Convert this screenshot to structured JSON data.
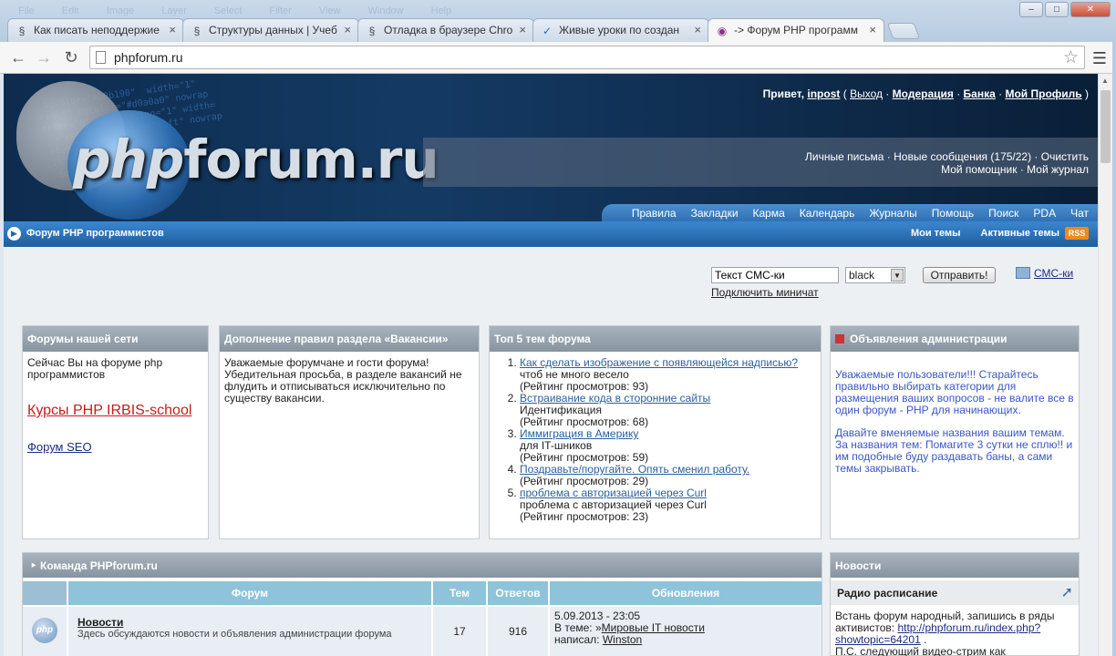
{
  "browser": {
    "ghost_menu": [
      "File",
      "Edit",
      "Image",
      "Layer",
      "Select",
      "Filter",
      "View",
      "Window",
      "Help"
    ],
    "tabs": [
      {
        "label": "Как писать неподдержие",
        "active": false,
        "icon": "page-icon"
      },
      {
        "label": "Структуры данных | Учеб",
        "active": false,
        "icon": "page-icon"
      },
      {
        "label": "Отладка в браузере Chro",
        "active": false,
        "icon": "page-icon"
      },
      {
        "label": "Живые уроки по создан",
        "active": false,
        "icon": "check-icon"
      },
      {
        "label": "-> Форум PHP программ",
        "active": true,
        "icon": "site-icon"
      }
    ],
    "url": "phpforum.ru"
  },
  "header": {
    "logo_prefix": "php",
    "logo_suffix": "forum.ru",
    "greeting": "Привет,",
    "username": "inpost",
    "logout": "Выход",
    "moderation": "Модерация",
    "bank": "Банка",
    "profile": "Мой Профиль",
    "messages_line1": "Личные письма · Новые сообщения (175/22) · Очистить",
    "messages_line2": "Мой помощник · Мой журнал",
    "nav": [
      "Правила",
      "Закладки",
      "Карма",
      "Календарь",
      "Журналы",
      "Помощь",
      "Поиск",
      "PDA",
      "Чат"
    ]
  },
  "forumbar": {
    "title": "Форум PHP программистов",
    "my_topics": "Мои темы",
    "active_topics": "Активные темы",
    "rss": "RSS"
  },
  "sms": {
    "input_value": "Текст СМС-ки",
    "color_select": "black",
    "send_button": "Отправить!",
    "sms_link": "СМС-ки",
    "thumbs_link": "Подключить миничат"
  },
  "panels": {
    "network": {
      "title": "Форумы нашей сети",
      "text": "Сейчас Вы на форуме php программистов",
      "link1": "Курсы PHP IRBIS-school",
      "link2": "Форум SEO"
    },
    "vacancies": {
      "title": "Дополнение правил раздела «Вакансии»",
      "text": "Уважаемые форумчане и гости форума! Убедительная просьба, в разделе вакансий не флудить и отписываться исключительно по существу вакансии."
    },
    "top5": {
      "title": "Топ 5 тем форума",
      "items": [
        {
          "link": "Как сделать изображение с появляющейся надписью?",
          "desc": "чтоб не много весело",
          "views": "(Рейтинг просмотров: 93)"
        },
        {
          "link": "Встраивание кода в сторонние сайты",
          "desc": "Идентификация",
          "views": "(Рейтинг просмотров: 68)"
        },
        {
          "link": "Иммиграция в Америку",
          "desc": "для IT-шников",
          "views": "(Рейтинг просмотров: 59)"
        },
        {
          "link": "Поздравьте/поругайте. Опять сменил работу.",
          "desc": "",
          "views": "(Рейтинг просмотров: 29)"
        },
        {
          "link": "проблема с авторизацией через Curl",
          "desc": "проблема с авторизацией через Curl",
          "views": "(Рейтинг просмотров: 23)"
        }
      ]
    },
    "admin": {
      "title": "Объявления администрации",
      "p1": "Уважаемые пользователи!!! Старайтесь правильно выбирать категории для размещения ваших вопросов - не валите все в один форум - PHP для начинающих.",
      "p2": "Давайте вменяемые названия вашим темам.",
      "p3": "За названия тем: Помагите 3 сутки не сплю!! и им подобные буду раздавать баны, а сами темы закрывать."
    }
  },
  "team": {
    "title": "Команда PHPforum.ru",
    "columns": [
      "Форум",
      "Тем",
      "Ответов",
      "Обновления"
    ],
    "row": {
      "name": "Новости",
      "desc": "Здесь обсуждаются новости и объявления администрации форума",
      "topics": "17",
      "replies": "916",
      "updated_date": "5.09.2013 - 23:05",
      "in_topic_label": "В теме:",
      "in_topic_link": "Мировые IT новости",
      "author_label": "написал:",
      "author": "Winston"
    }
  },
  "news": {
    "title": "Новости",
    "subtitle": "Радио расписание",
    "text1": "Встань форум народный, запишись в ряды активистов:",
    "link": "http://phpforum.ru/index.php?showtopic=64201",
    "text2": "П.С. следующий видео-стрим как"
  }
}
